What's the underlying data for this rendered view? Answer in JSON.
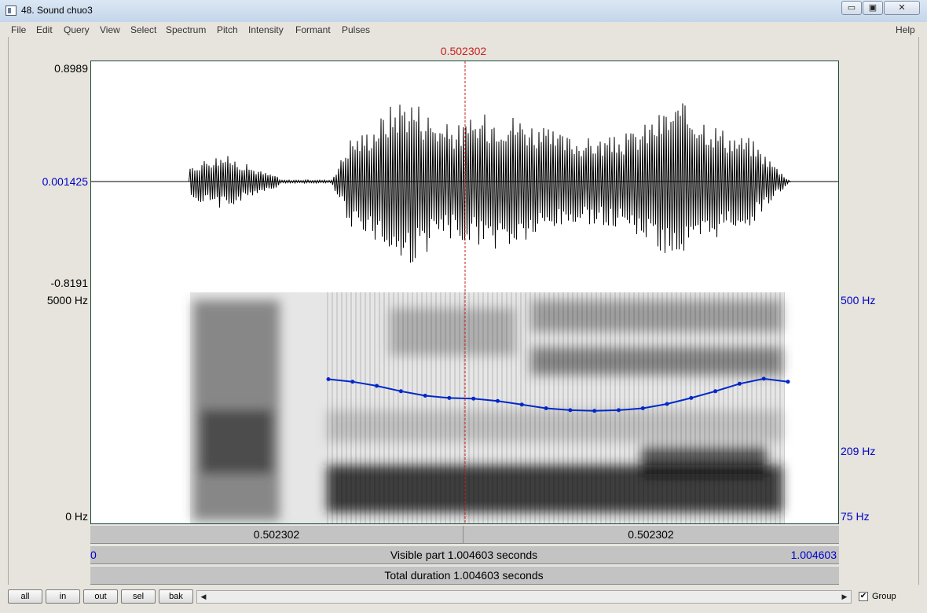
{
  "window": {
    "title": "48. Sound chuo3",
    "icon": "praat-window-icon",
    "controls": {
      "minimize": "▭",
      "maximize": "▣",
      "close": "✕"
    }
  },
  "menu": [
    "File",
    "Edit",
    "Query",
    "View",
    "Select",
    "Spectrum",
    "Pitch",
    "Intensity",
    "Formant",
    "Pulses"
  ],
  "help_label": "Help",
  "cursor": {
    "time": "0.502302",
    "color": "#c81e1e"
  },
  "waveform": {
    "max_label": "0.8989",
    "zero_label": "0.001425",
    "min_label": "-0.8191"
  },
  "spectrogram": {
    "freq_max_label": "5000 Hz",
    "freq_min_label": "0 Hz",
    "pitch_max_label": "500 Hz",
    "pitch_mid_label": "209 Hz",
    "pitch_min_label": "75 Hz",
    "pitch_color": "#0028c8",
    "pitch_curve_hz": [
      245,
      240,
      232,
      222,
      214,
      210,
      209,
      205,
      199,
      193,
      190,
      189,
      190,
      193,
      200,
      210,
      222,
      236,
      246,
      240
    ]
  },
  "time_bars": {
    "left_segment": "0.502302",
    "right_segment": "0.502302",
    "visible_start": "0",
    "visible_label": "Visible part 1.004603 seconds",
    "visible_end": "1.004603",
    "total_label": "Total duration 1.004603 seconds"
  },
  "nav_buttons": [
    "all",
    "in",
    "out",
    "sel",
    "bak"
  ],
  "scroll_arrows": {
    "left": "◀",
    "right": "▶"
  },
  "group": {
    "label": "Group",
    "checked": true,
    "check": "✔"
  }
}
